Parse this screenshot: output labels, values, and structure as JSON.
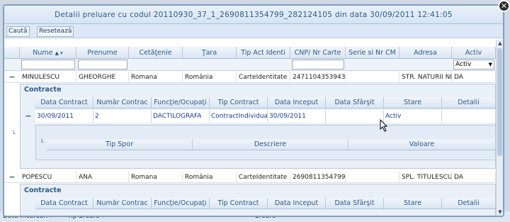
{
  "dialog": {
    "title": "Detalii preluare cu codul 20110930_37_1_2690811354799_282124105 din data 30/09/2011 12:41:05",
    "close_label": "✕"
  },
  "toolbar": {
    "search_label": "Caută",
    "reset_label": "Resetează"
  },
  "grid": {
    "columns": [
      "Nume",
      "Prenume",
      "Cetăţenie",
      "Ţara",
      "Tip Act Identi",
      "CNP/ Nr Carte",
      "Serie si Nr CM",
      "Adresa",
      "Activ"
    ],
    "sort_indicator": "▲ ▾",
    "filter_activ_value": "Activ",
    "rows": [
      {
        "expander": "−",
        "nume": "MINULESCU",
        "prenume": "GHEORGHE",
        "cetatenie": "Romana",
        "tara": "România",
        "tip_act": "CarteIdentitate",
        "cnp": "2471104353943",
        "serie": "",
        "adresa": "STR. NATURII NR",
        "activ": "DA"
      },
      {
        "expander": "−",
        "nume": "POPESCU",
        "prenume": "ANA",
        "cetatenie": "Romana",
        "tara": "România",
        "tip_act": "CarteIdentitate",
        "cnp": "2690811354799",
        "serie": "",
        "adresa": "SPL. TITULESCU NR",
        "activ": "DA"
      }
    ]
  },
  "contracte": {
    "title": "Contracte",
    "columns": [
      "Data Contract",
      "Număr Contrac",
      "Funcţie/Ocupaţi",
      "Tip Contract",
      "Data Inceput",
      "Data Sfârşit",
      "Stare",
      "Detalii"
    ],
    "row": {
      "expander": "−",
      "data_contract": "30/09/2011",
      "numar": "2",
      "functie": "DACTILOGRAFA",
      "tip": "ContractIndividual",
      "data_inceput": "30/09/2011",
      "data_sfarsit": "",
      "stare": "Activ",
      "detalii": ""
    },
    "spor_columns": [
      "Tip Spor",
      "Descriere",
      "Valoare"
    ]
  },
  "background": {
    "left_label": "Data Incarcari ▾",
    "mid_label": "Tip Eroare ▾",
    "right_label": "Eroare"
  },
  "colors": {
    "accent": "#2d5a8c",
    "header_bg": "#dbe6f2",
    "link": "#1a3d8f"
  }
}
